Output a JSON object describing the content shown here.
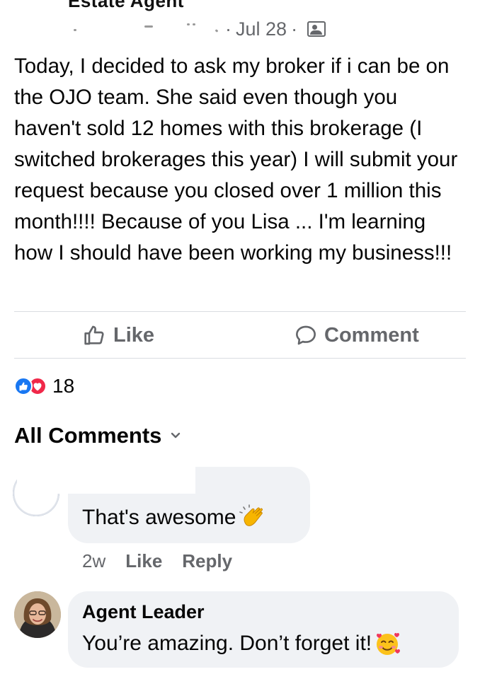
{
  "post": {
    "author_title_partial": "Estate Agent",
    "meta_sep": "·",
    "date": "Jul 28",
    "privacy_icon": "friends-privacy-icon",
    "text": "Today, I decided to ask my broker if i can be on the OJO team. She said even though you haven't sold 12 homes with this brokerage (I switched brokerages this year) I will submit your request because you closed over 1 million this month!!!! Because of you Lisa ... I'm learning how I should have been working my business!!!"
  },
  "actions": {
    "like_label": "Like",
    "comment_label": "Comment"
  },
  "reactions": {
    "icons": [
      "like-reaction-icon",
      "love-reaction-icon"
    ],
    "count": "18",
    "like_color": "#1877f2",
    "love_color": "#f02849"
  },
  "comments_section": {
    "header": "All Comments",
    "comments": [
      {
        "author_redacted": true,
        "text": "That's awesome",
        "emoji_icon": "clapping-hands-icon",
        "time": "2w",
        "like_label": "Like",
        "reply_label": "Reply"
      },
      {
        "author": "Agent Leader",
        "text": "You’re amazing. Don’t forget it!",
        "emoji_icon": "smiling-face-with-hearts-icon"
      }
    ]
  },
  "colors": {
    "text": "#050505",
    "secondary_text": "#65676b",
    "bubble_bg": "#f0f2f5",
    "divider": "#dadde1"
  }
}
